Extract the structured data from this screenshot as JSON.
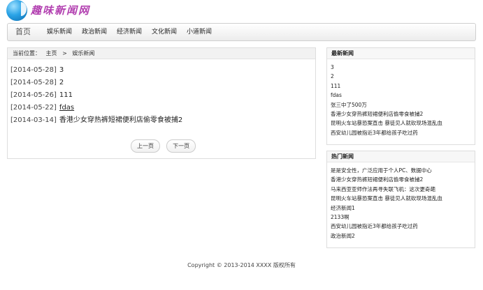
{
  "site": {
    "logo_text": "趣味新闻网"
  },
  "nav": {
    "home": "首页",
    "items": [
      "娱乐新闻",
      "政治新闻",
      "经济新闻",
      "文化新闻",
      "小道新闻"
    ]
  },
  "breadcrumb": {
    "label": "当前位置：",
    "home": "主页",
    "sep": ">",
    "current": "娱乐新闻"
  },
  "news": [
    {
      "date": "[2014-05-28]",
      "title": "3"
    },
    {
      "date": "[2014-05-28]",
      "title": "2"
    },
    {
      "date": "[2014-05-26]",
      "title": "111"
    },
    {
      "date": "[2014-05-22]",
      "title": "fdas"
    },
    {
      "date": "[2014-03-14]",
      "title": "香港少女穿热裤短裙便利店偷零食被捕2"
    }
  ],
  "pager": {
    "prev": "上一页",
    "next": "下一页"
  },
  "latest": {
    "title": "最新新闻",
    "items": [
      "3",
      "2",
      "111",
      "fdas",
      "张三中了500万",
      "香港少女穿热裤短裙便利店偷零食被捕2",
      "昆明火车站暴恐案直击 暴徒见人就砍现场混乱血",
      "西安幼儿园被指近3年都给孩子吃过药"
    ]
  },
  "hot": {
    "title": "热门新闻",
    "items": [
      "是是安全性，广泛应用于个人PC、数据中心",
      "香港少女穿热裤短裙便利店偷零食被捕2",
      "马来西亚亚师作法再寻失联飞机：这次更奇葩",
      "昆明火车站暴恐案直击 暴徒见人就砍现场混乱血",
      "经济新闻1",
      "2133啊",
      "西安幼儿园被指近3年都给孩子吃过药",
      "政治新闻2"
    ]
  },
  "footer": "Copyright © 2013-2014 XXXX 版权所有"
}
